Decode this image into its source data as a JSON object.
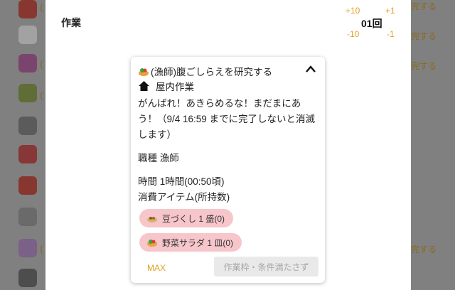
{
  "sheet": {
    "title": "作業",
    "stepper": {
      "plus10": "+10",
      "plus1": "+1",
      "minus10": "-10",
      "minus1": "-1",
      "count": "01回"
    }
  },
  "background": {
    "suffix": "完する",
    "paren": "("
  },
  "card": {
    "title": "(漁師)腹ごしらえを研究する",
    "location": "屋内作業",
    "message": "がんばれ！あきらめるな！まだまにあう！（9/4 16:59 までに完了しないと消滅します）",
    "job_label": "職種 漁師",
    "time_label": "時間 1時間(00:50頃)",
    "consume_label": "消費アイテム(所持数)",
    "items": [
      {
        "label": "豆づくし 1 盛(0)"
      },
      {
        "label": "野菜サラダ 1 皿(0)"
      }
    ],
    "max_label": "MAX",
    "submit_label": "作業枠・条件満たさず"
  },
  "colors": {
    "accent": "#e0a020",
    "pill": "#f6c6cb",
    "disabled": "#e9e9e9"
  }
}
